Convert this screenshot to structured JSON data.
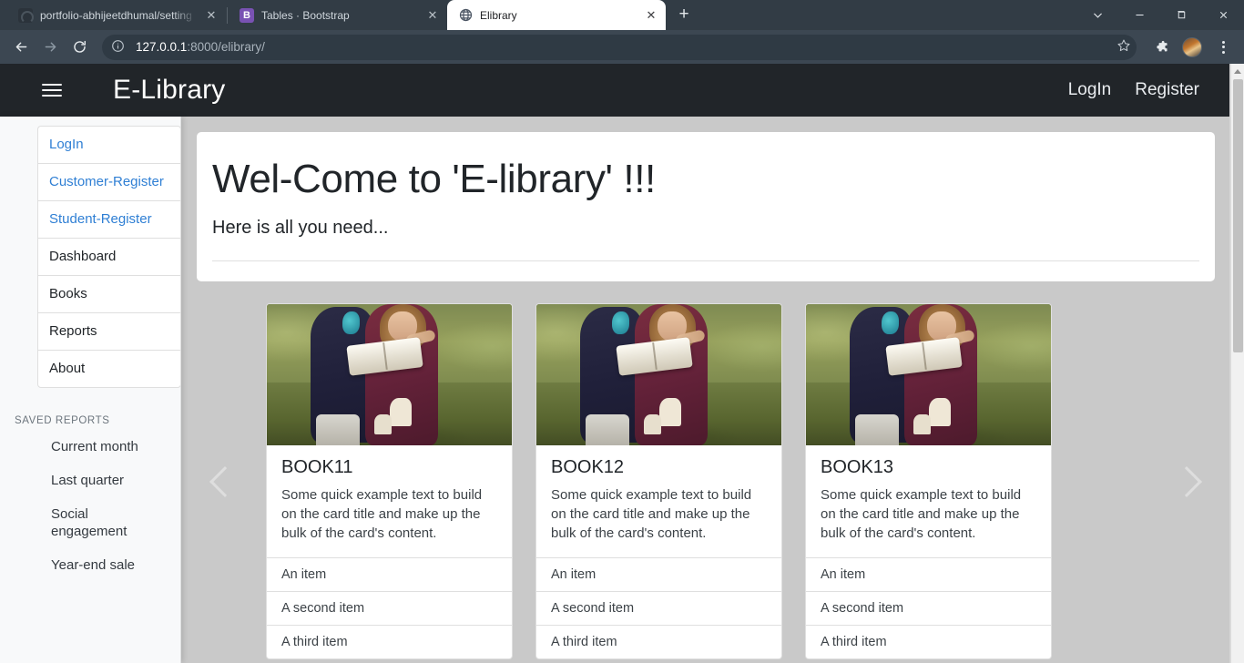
{
  "browser": {
    "tabs": [
      {
        "title": "portfolio-abhijeetdhumal/setting",
        "favicon": "github-icon",
        "active": false
      },
      {
        "title": "Tables · Bootstrap",
        "favicon": "bootstrap-icon",
        "active": false
      },
      {
        "title": "Elibrary",
        "favicon": "globe-icon",
        "active": true
      }
    ],
    "new_tab_label": "+",
    "close_label": "✕",
    "window_controls": {
      "tab_search": "⌄",
      "minimize": "—",
      "maximize": "❐",
      "close": "✕"
    },
    "toolbar": {
      "back": "←",
      "forward": "→",
      "reload": "⟳",
      "site_info": "ⓘ",
      "url_host": "127.0.0.1",
      "url_rest": ":8000/elibrary/",
      "bookmark_star": "☆",
      "extensions": "🧩",
      "profile": "avatar",
      "menu": "⋮"
    }
  },
  "navbar": {
    "menu_toggle": "hamburger-icon",
    "brand": "E-Library",
    "links": [
      {
        "label": "LogIn"
      },
      {
        "label": "Register"
      }
    ]
  },
  "sidebar": {
    "list_group": [
      {
        "label": "LogIn",
        "style": "link"
      },
      {
        "label": "Customer-Register",
        "style": "link"
      },
      {
        "label": "Student-Register",
        "style": "link"
      },
      {
        "label": "Dashboard",
        "style": "plain"
      },
      {
        "label": "Books",
        "style": "plain"
      },
      {
        "label": "Reports",
        "style": "plain"
      },
      {
        "label": "About",
        "style": "plain"
      }
    ],
    "saved_reports_title": "SAVED REPORTS",
    "saved_reports": [
      {
        "label": "Current month"
      },
      {
        "label": "Last quarter"
      },
      {
        "label": "Social engagement"
      },
      {
        "label": "Year-end sale"
      }
    ]
  },
  "jumbotron": {
    "title": "Wel-Come to 'E-library' !!!",
    "lead": "Here is all you need..."
  },
  "carousel": {
    "prev_label": "‹",
    "next_label": "›",
    "cards": [
      {
        "title": "BOOK11",
        "text": "Some quick example text to build on the card title and make up the bulk of the card's content.",
        "image_alt": "children-reading-book-photo",
        "items": [
          "An item",
          "A second item",
          "A third item"
        ]
      },
      {
        "title": "BOOK12",
        "text": "Some quick example text to build on the card title and make up the bulk of the card's content.",
        "image_alt": "children-reading-book-photo",
        "items": [
          "An item",
          "A second item",
          "A third item"
        ]
      },
      {
        "title": "BOOK13",
        "text": "Some quick example text to build on the card title and make up the bulk of the card's content.",
        "image_alt": "children-reading-book-photo",
        "items": [
          "An item",
          "A second item",
          "A third item"
        ]
      }
    ]
  },
  "colors": {
    "navbar_bg": "#212529",
    "link_blue": "#2f7fd4",
    "content_bg": "#c9c9c9",
    "sidebar_bg": "#f8f9fa",
    "browser_chrome": "#323c45"
  }
}
